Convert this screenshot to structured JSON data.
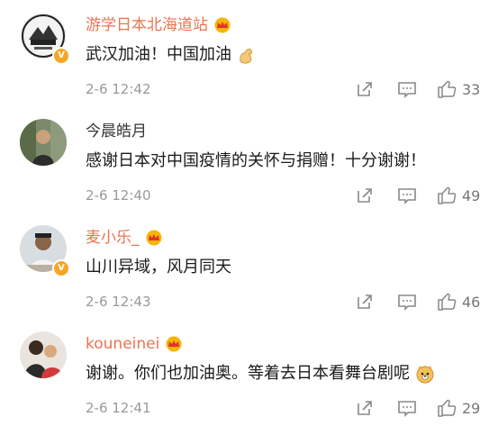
{
  "comments": [
    {
      "username": "游学日本北海道站",
      "vip": true,
      "verified": true,
      "text": "武汉加油！中国加油",
      "emoji": "flexed-biceps",
      "time": "2-6 12:42",
      "likes": "33"
    },
    {
      "username": "今晨皓月",
      "vip": false,
      "verified": false,
      "text": "感谢日本对中国疫情的关怀与捐赠！十分谢谢！",
      "emoji": "",
      "time": "2-6 12:40",
      "likes": "49"
    },
    {
      "username": "麦小乐_",
      "vip": true,
      "verified": true,
      "text": "山川异域，风月同天",
      "emoji": "",
      "time": "2-6 12:43",
      "likes": "46"
    },
    {
      "username": "kouneinei",
      "vip": true,
      "verified": false,
      "text": "谢谢。你们也加油奥。等着去日本看舞台剧呢",
      "emoji": "doge",
      "time": "2-6 12:41",
      "likes": "29"
    }
  ],
  "colors": {
    "vip_name": "#eb7350",
    "meta": "#999999",
    "badge": "#f5a623"
  }
}
